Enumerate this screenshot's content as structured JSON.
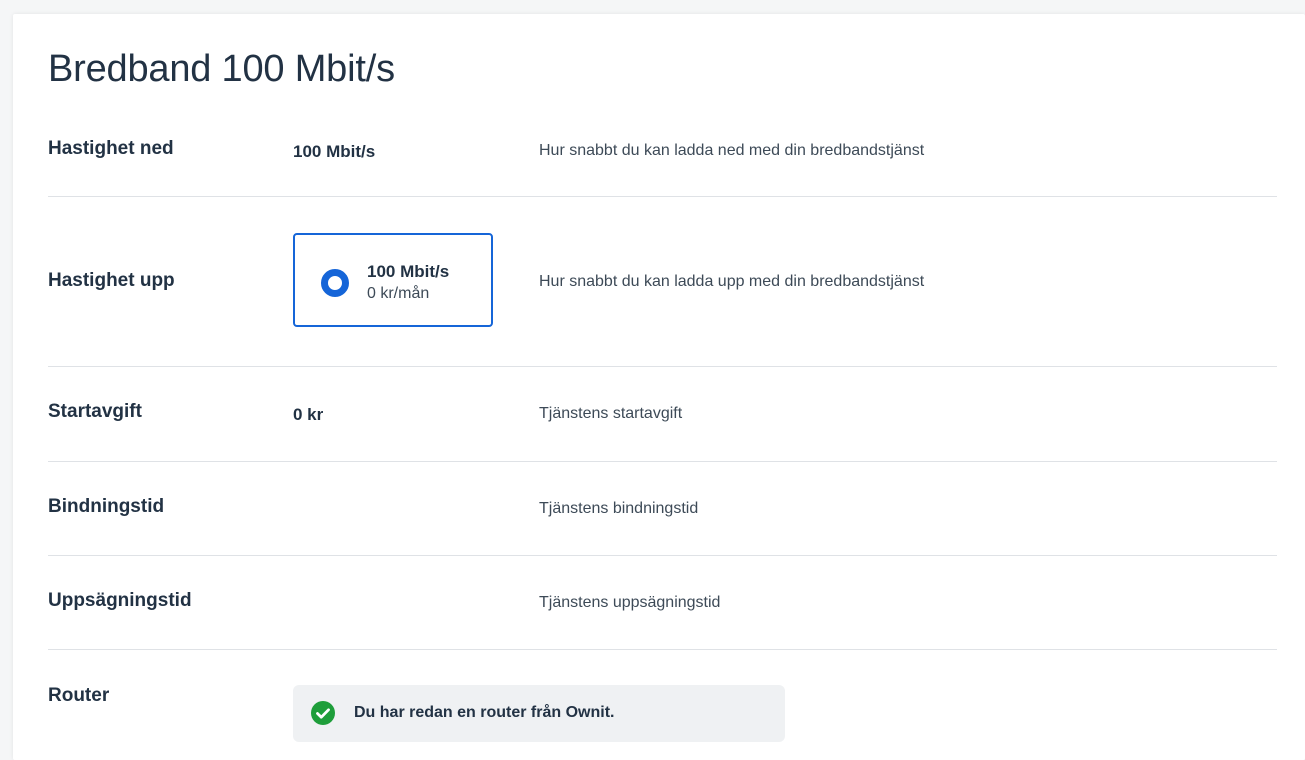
{
  "title": "Bredband 100 Mbit/s",
  "rows": {
    "download": {
      "label": "Hastighet ned",
      "value": "100 Mbit/s",
      "description": "Hur snabbt du kan ladda ned med din bredbandstjänst"
    },
    "upload": {
      "label": "Hastighet upp",
      "option": {
        "speed": "100 Mbit/s",
        "price": "0 kr/mån",
        "selected": true
      },
      "description": "Hur snabbt du kan ladda upp med din bredbandstjänst"
    },
    "start_fee": {
      "label": "Startavgift",
      "value": "0 kr",
      "description": "Tjänstens startavgift"
    },
    "binding": {
      "label": "Bindningstid",
      "description": "Tjänstens bindningstid"
    },
    "notice_period": {
      "label": "Uppsägningstid",
      "description": "Tjänstens uppsägningstid"
    },
    "router": {
      "label": "Router",
      "notice": "Du har redan en router från Ownit.",
      "notice_icon": "check-circle-icon"
    }
  },
  "colors": {
    "accent": "#1565d8",
    "success": "#1e9e3a",
    "text": "#223244"
  }
}
